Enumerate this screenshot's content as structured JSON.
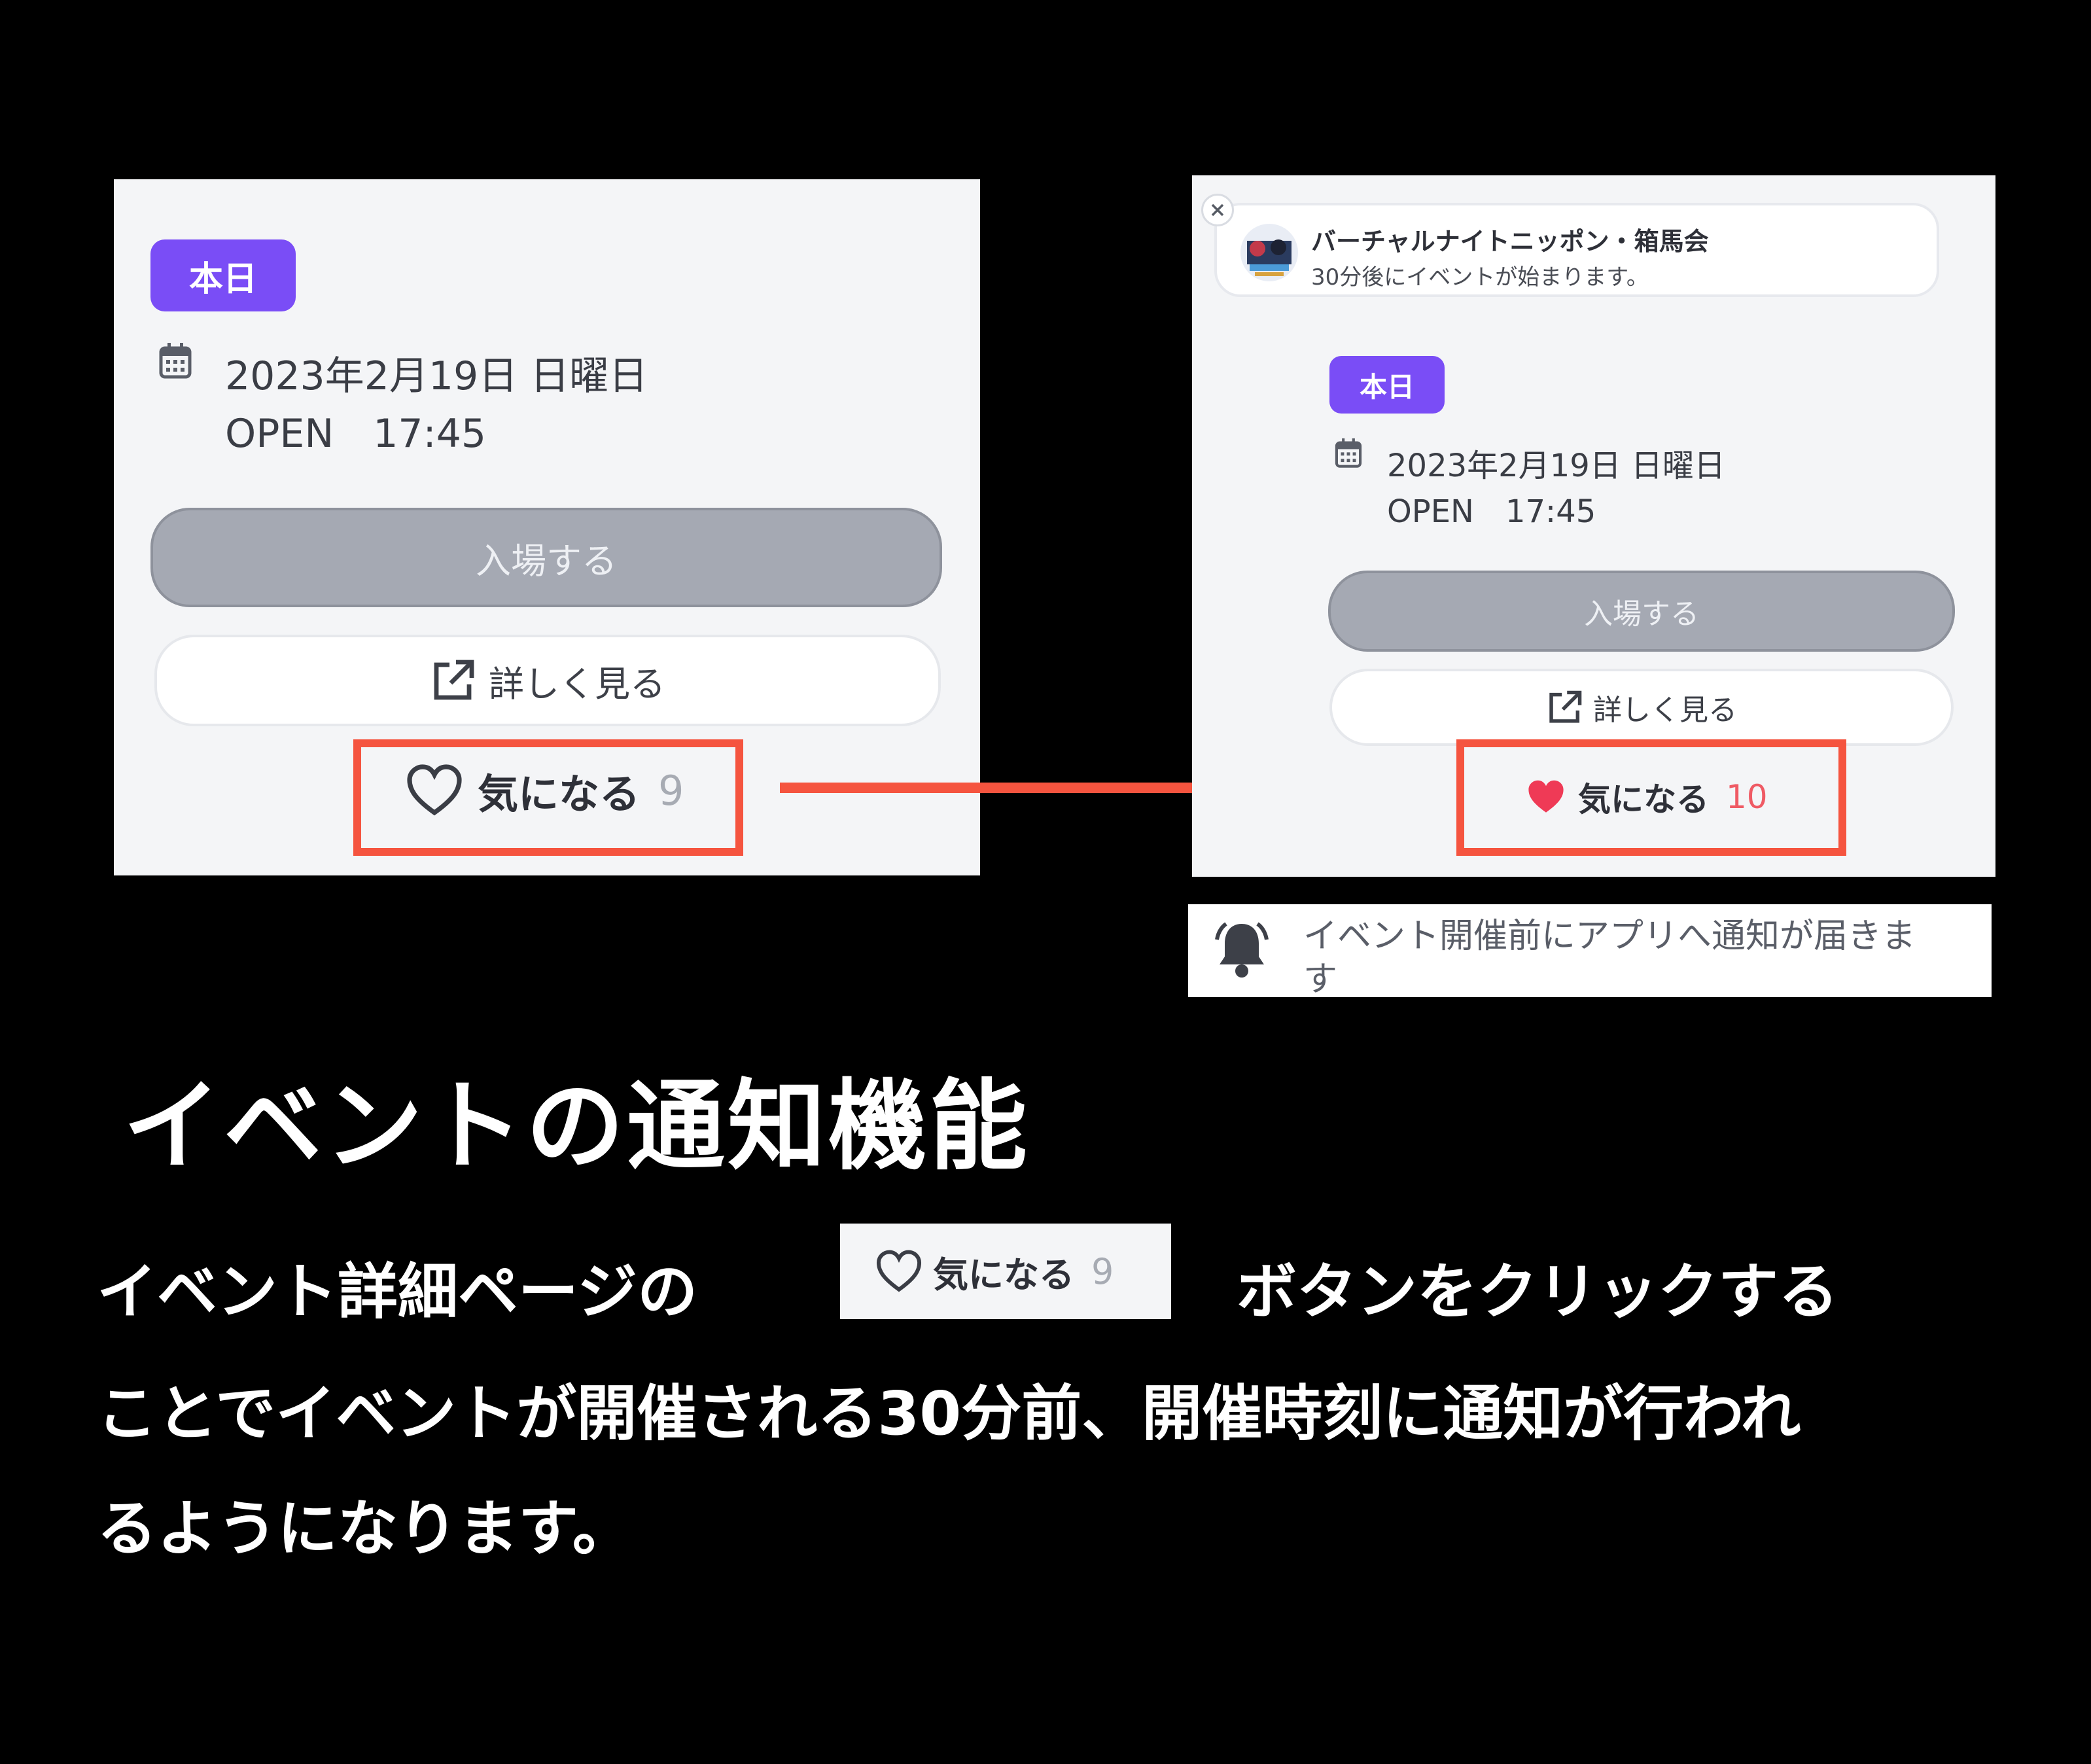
{
  "left_panel": {
    "badge": "本日",
    "date": "2023年2月19日 日曜日",
    "open": "OPEN　17:45",
    "enter_button": "入場する",
    "details_button": "詳しく見る",
    "interest_label": "気になる",
    "interest_count": "9"
  },
  "right_panel": {
    "notification": {
      "title": "バーチャルナイトニッポン・箱馬会",
      "body": "30分後にイベントが始まります。"
    },
    "badge": "本日",
    "date": "2023年2月19日 日曜日",
    "open": "OPEN　17:45",
    "enter_button": "入場する",
    "details_button": "詳しく見る",
    "interest_label": "気になる",
    "interest_count": "10"
  },
  "notice_bar": {
    "line1": "イベント開催前にアプリへ通知が届きま",
    "line2": "す"
  },
  "heading": "イベントの通知機能",
  "body": {
    "line1_pre": "イベント詳細ページの",
    "inline_button_label": "気になる",
    "inline_button_count": "9",
    "line1_post": "ボタンをクリックする",
    "line2": "ことでイベントが開催される30分前、開催時刻に通知が行われ",
    "line3": "るようになります。"
  },
  "colors": {
    "background": "#000000",
    "badge": "#7a4df6",
    "highlight": "#f5543f",
    "heart_filled": "#ef3a56"
  }
}
